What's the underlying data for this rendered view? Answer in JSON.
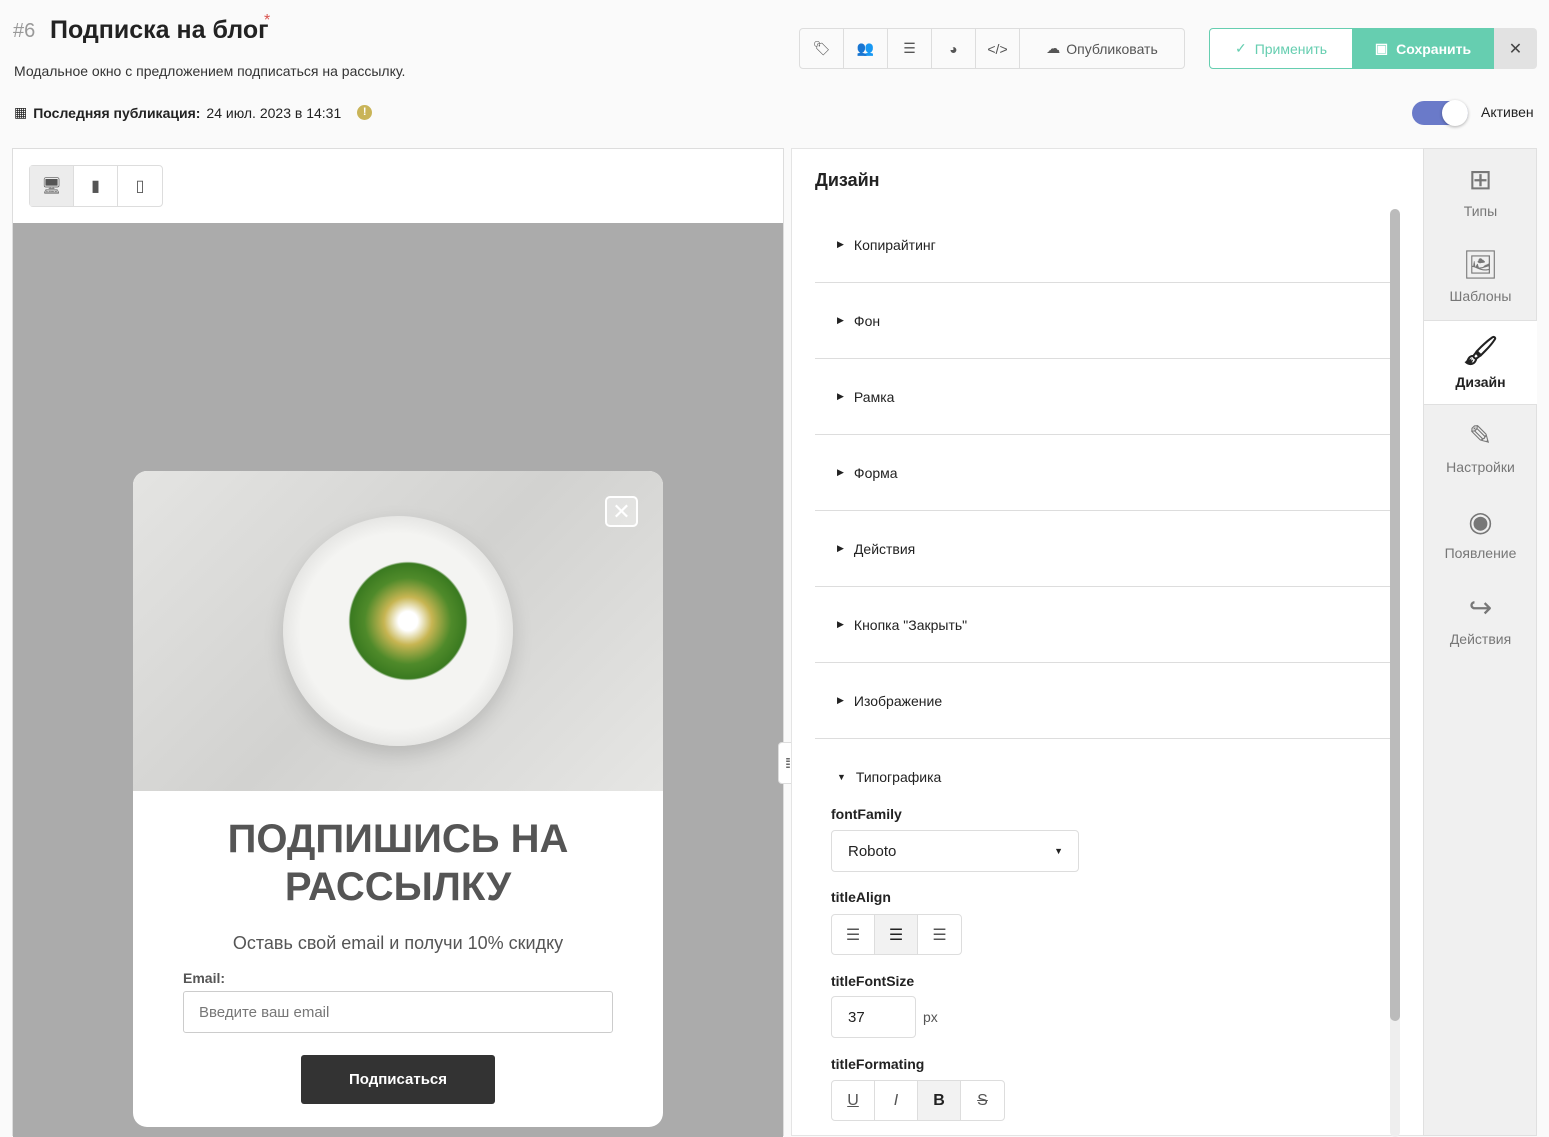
{
  "header": {
    "number": "#6",
    "title": "Подписка на блог",
    "required_mark": "*",
    "description": "Модальное окно с предложением подписаться на рассылку.",
    "last_pub_label": "Последняя публикация:",
    "last_pub_value": "24 июл. 2023 в 14:31",
    "warn": "!"
  },
  "toolbar": {
    "publish": "Опубликовать",
    "apply": "Применить",
    "save": "Сохранить",
    "close": "✕"
  },
  "status": {
    "active_label": "Активен",
    "active": true
  },
  "preview": {
    "modal": {
      "close": "✕",
      "heading": "ПОДПИШИСЬ НА РАССЫЛКУ",
      "subtitle": "Оставь свой email и получи 10% скидку",
      "email_label": "Email:",
      "email_placeholder": "Введите ваш email",
      "button": "Подписаться"
    }
  },
  "design": {
    "title": "Дизайн",
    "sections": [
      "Копирайтинг",
      "Фон",
      "Рамка",
      "Форма",
      "Действия",
      "Кнопка \"Закрыть\"",
      "Изображение"
    ],
    "open_section": "Типографика",
    "fontFamily_label": "fontFamily",
    "fontFamily_value": "Roboto",
    "titleAlign_label": "titleAlign",
    "titleFontSize_label": "titleFontSize",
    "titleFontSize_value": "37",
    "unit": "px",
    "titleFormating_label": "titleFormating"
  },
  "sidebar": {
    "items": [
      "Типы",
      "Шаблоны",
      "Дизайн",
      "Настройки",
      "Появление",
      "Действия"
    ]
  },
  "colors": {
    "accent": "#66ceb0",
    "toggle": "#6a7ac9",
    "warn": "#c9b458"
  }
}
